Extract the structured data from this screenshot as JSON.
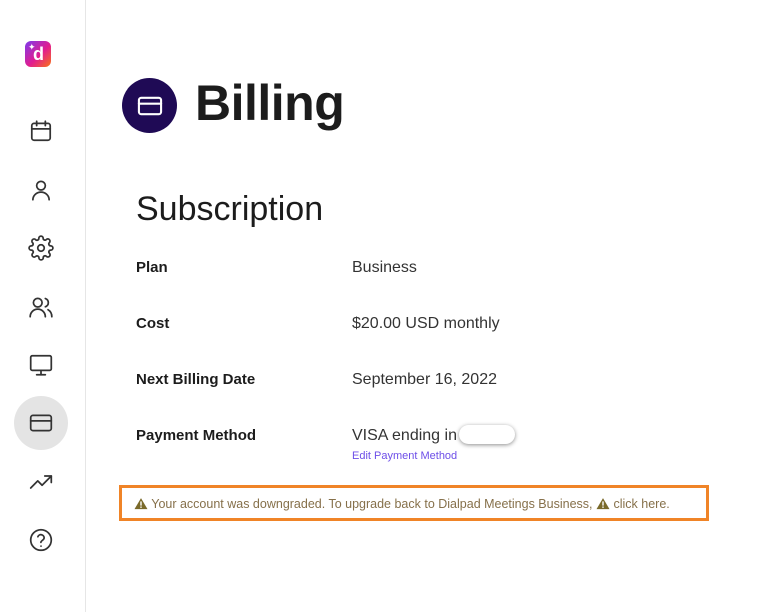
{
  "app": {
    "logo_letter": "d",
    "brand_color": "#e11d8f"
  },
  "sidebar": {
    "items": [
      {
        "name": "calendar",
        "icon": "calendar-icon",
        "active": false
      },
      {
        "name": "profile",
        "icon": "user-icon",
        "active": false
      },
      {
        "name": "settings",
        "icon": "gear-icon",
        "active": false
      },
      {
        "name": "users",
        "icon": "users-icon",
        "active": false
      },
      {
        "name": "rooms",
        "icon": "monitor-icon",
        "active": false
      },
      {
        "name": "billing",
        "icon": "credit-card-icon",
        "active": true
      },
      {
        "name": "analytics",
        "icon": "trending-up-icon",
        "active": false
      },
      {
        "name": "help",
        "icon": "help-circle-icon",
        "active": false
      }
    ]
  },
  "page": {
    "title": "Billing",
    "title_icon": "credit-card-icon",
    "title_icon_bg": "#1f0a55"
  },
  "subscription": {
    "section_title": "Subscription",
    "rows": [
      {
        "label": "Plan",
        "value": "Business"
      },
      {
        "label": "Cost",
        "value": "$20.00 USD monthly"
      },
      {
        "label": "Next Billing Date",
        "value": "September 16, 2022"
      },
      {
        "label": "Payment Method",
        "value": "VISA ending in"
      }
    ],
    "edit_payment_label": "Edit Payment Method"
  },
  "warning": {
    "message": "Your account was downgraded. To upgrade back to Dialpad Meetings Business,",
    "link_text": "click here.",
    "icon": "warning-triangle-icon",
    "border_color": "#f08427"
  }
}
